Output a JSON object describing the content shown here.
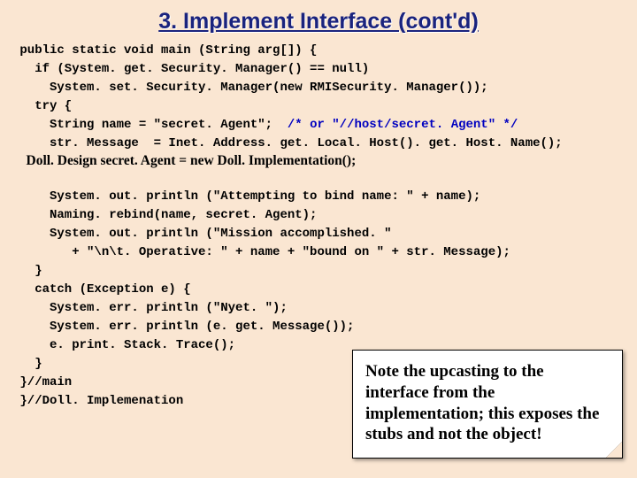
{
  "title": "3. Implement Interface (cont'd)",
  "code": {
    "l1": " public static void main (String arg[]) {",
    "l2": "   if (System. get. Security. Manager() == null)",
    "l3": "     System. set. Security. Manager(new RMISecurity. Manager());",
    "l4": "   try {",
    "l5": "     String name = \"secret. Agent\";  ",
    "l5c": "/* or \"//host/secret. Agent\" */",
    "l6": "     str. Message  = Inet. Address. get. Local. Host(). get. Host. Name();",
    "l7": "",
    "bold": "    Doll. Design secret. Agent = new Doll. Implementation();",
    "l8": "",
    "l9": "     System. out. println (\"Attempting to bind name: \" + name);",
    "l10": "     Naming. rebind(name, secret. Agent);",
    "l11": "     System. out. println (\"Mission accomplished. \"",
    "l12": "        + \"\\n\\t. Operative: \" + name + \"bound on \" + str. Message);",
    "l13": "   }",
    "l14": "   catch (Exception e) {",
    "l15": "     System. err. println (\"Nyet. \");",
    "l16": "     System. err. println (e. get. Message());",
    "l17": "     e. print. Stack. Trace();",
    "l18": "   }",
    "l19": " }//main",
    "l20": " }//Doll. Implemenation"
  },
  "note": "Note the upcasting to the interface from the implementation; this exposes the stubs and not the object!"
}
